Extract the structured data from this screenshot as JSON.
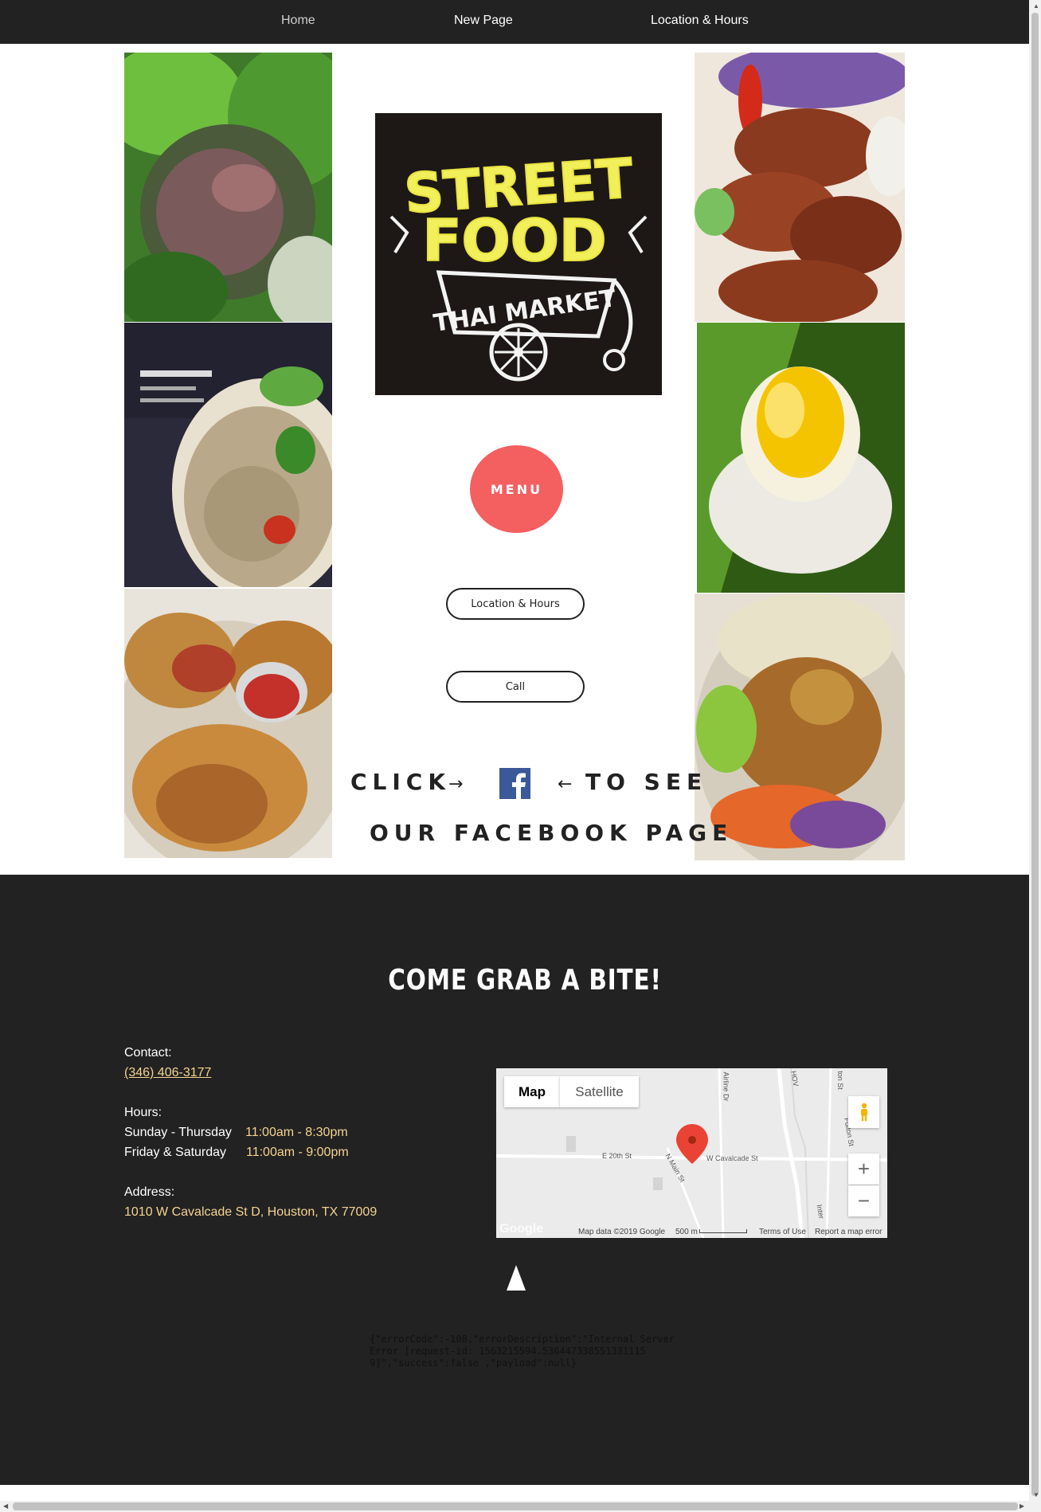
{
  "nav": {
    "items": [
      {
        "label": "Home"
      },
      {
        "label": "New Page"
      },
      {
        "label": "Location & Hours"
      }
    ]
  },
  "main": {
    "logo_text": {
      "line1": "STREET",
      "line2": "FOOD",
      "line3": "THAI MARKET"
    },
    "menu_button": "MENU",
    "location_button": "Location & Hours",
    "call_button": "Call",
    "facebook": {
      "click": "CLICK",
      "arrow_right": "→",
      "arrow_left": "←",
      "to_see": "TO SEE",
      "line2": "OUR FACEBOOK PAGE"
    }
  },
  "footer": {
    "title": "COME GRAB A BITE!",
    "contact_label": "Contact:",
    "phone": "(346) 406-3177",
    "hours_label": "Hours:",
    "hours": [
      {
        "days": "Sunday - Thursday",
        "time": "11:00am - 8:30pm"
      },
      {
        "days": "Friday & Saturday",
        "time": "11:00am - 9:00pm"
      }
    ],
    "address_label": "Address:",
    "address": "1010 W Cavalcade St D, Houston, TX 77009",
    "map": {
      "tab_map": "Map",
      "tab_satellite": "Satellite",
      "roads": [
        "E 20th St",
        "W Cavalcade St",
        "N Main St",
        "Airline Dr",
        "HOV",
        "Fulton St",
        "ton St",
        "Inter"
      ],
      "attribution": "Map data ©2019 Google",
      "scale": "500 m",
      "terms": "Terms of Use",
      "report": "Report a map error",
      "google": "Google"
    },
    "error_text": "{\"errorCode\":-108,\"errorDescription\":\"Internal Server Error [request-id: 1563215594.5364473385513311159]\",\"success\":false ,\"payload\":null}"
  },
  "colors": {
    "nav_bg": "#222222",
    "menu_button": "#f45f60",
    "gold_text": "#f4d38f",
    "footer_bg": "#222222",
    "facebook_blue": "#3b5998"
  }
}
